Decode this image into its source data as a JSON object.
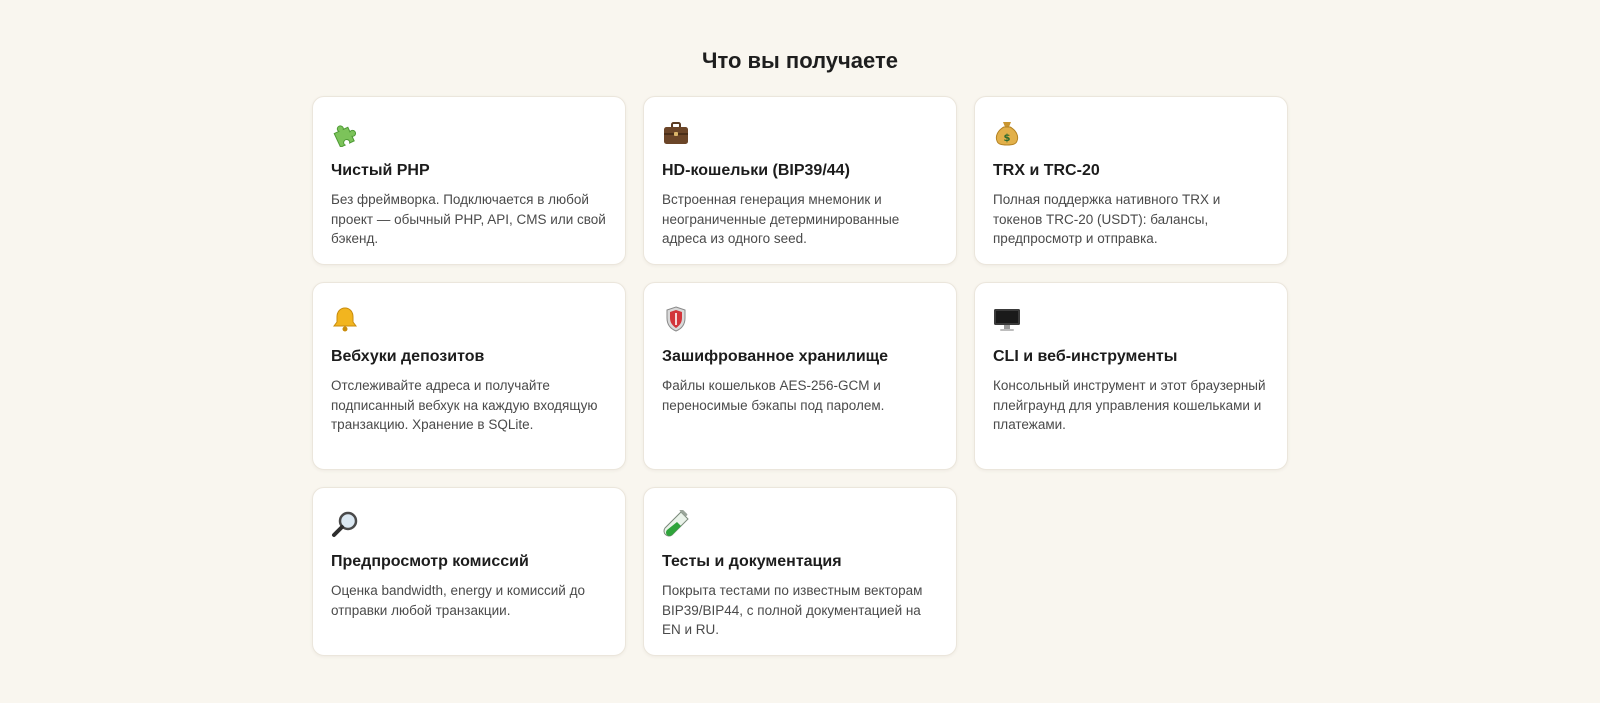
{
  "section": {
    "title": "Что вы получаете"
  },
  "features": [
    {
      "icon": "puzzle-piece-icon",
      "title": "Чистый PHP",
      "description": "Без фреймворка. Подключается в любой проект — обычный PHP, API, CMS или свой бэкенд."
    },
    {
      "icon": "briefcase-icon",
      "title": "HD-кошельки (BIP39/44)",
      "description": "Встроенная генерация мнемоник и неограниченные детерминированные адреса из одного seed."
    },
    {
      "icon": "money-bag-icon",
      "title": "TRX и TRC-20",
      "description": "Полная поддержка нативного TRX и токенов TRC-20 (USDT): балансы, предпросмотр и отправка."
    },
    {
      "icon": "bell-icon",
      "title": "Вебхуки депозитов",
      "description": "Отслеживайте адреса и получайте подписанный вебхук на каждую входящую транзакцию. Хранение в SQLite."
    },
    {
      "icon": "shield-icon",
      "title": "Зашифрованное хранилище",
      "description": "Файлы кошельков AES-256-GCM и переносимые бэкапы под паролем."
    },
    {
      "icon": "desktop-computer-icon",
      "title": "CLI и веб-инструменты",
      "description": "Консольный инструмент и этот браузерный плейграунд для управления кошельками и платежами."
    },
    {
      "icon": "magnifying-glass-icon",
      "title": "Предпросмотр комиссий",
      "description": "Оценка bandwidth, energy и комиссий до отправки любой транзакции."
    },
    {
      "icon": "test-tube-icon",
      "title": "Тесты и документация",
      "description": "Покрыта тестами по известным векторам BIP39/BIP44, с полной документацией на EN и RU."
    }
  ]
}
